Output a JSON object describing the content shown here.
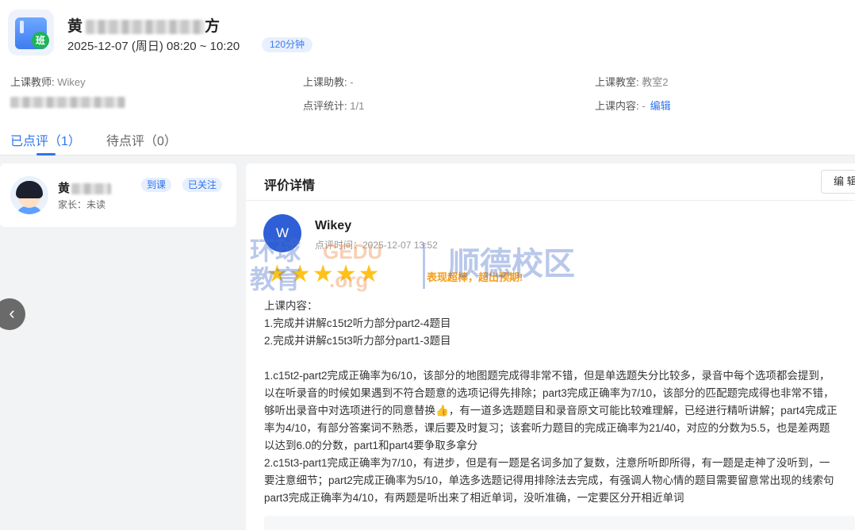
{
  "header": {
    "title_prefix": "黄",
    "title_suffix": "方",
    "time": "2025-12-07 (周日) 08:20 ~ 10:20",
    "duration": "120分钟",
    "icon_badge": "班"
  },
  "info": {
    "teacher_label": "上课教师:",
    "teacher_value": "Wikey",
    "assistant_label": "上课助教:",
    "assistant_value": "-",
    "room_label": "上课教室:",
    "room_value": "教室2",
    "stats_label": "点评统计:",
    "stats_value": "1/1",
    "content_label": "上课内容:",
    "content_value": "-",
    "content_edit": "编辑"
  },
  "tabs": [
    {
      "label": "已点评（1）",
      "active": true
    },
    {
      "label": "待点评（0）",
      "active": false
    }
  ],
  "student": {
    "name_prefix": "黄",
    "parent": "家长：未读",
    "tag_attend": "到课",
    "tag_follow": "已关注"
  },
  "detail": {
    "title": "评价详情",
    "edit_label": "编 辑",
    "reviewer_initial": "W",
    "reviewer_name": "Wikey",
    "review_time": "点评时间：2025-12-07 13:52",
    "stars": "★★★★★",
    "rating_text": "表现超棒，超出预期!",
    "body_lines": [
      "上课内容：",
      "1.完成并讲解c15t2听力部分part2-4题目",
      "2.完成并讲解c15t3听力部分part1-3题目",
      "",
      "1.c15t2-part2完成正确率为6/10，该部分的地图题完成得非常不错，但是单选题失分比较多，录音中每个选项都会提到，",
      "以在听录音的时候如果遇到不符合题意的选项记得先排除；part3完成正确率为7/10，该部分的匹配题完成得也非常不错，",
      "够听出录音中对选项进行的同意替换👍，有一道多选题题目和录音原文可能比较难理解，已经进行精听讲解；part4完成正",
      "率为4/10，有部分答案词不熟悉，课后要及时复习；该套听力题目的完成正确率为21/40，对应的分数为5.5，也是差两题",
      "以达到6.0的分数，part1和part4要争取多拿分",
      "2.c15t3-part1完成正确率为7/10，有进步，但是有一题是名词多加了复数，注意所听即所得，有一题是走神了没听到，一",
      "要注意细节；part2完成正确率为5/10，单选多选题记得用排除法去完成，有强调人物心情的题目需要留意常出现的线索句",
      "part3完成正确率为4/10，有两题是听出来了相近单词，没听准确，一定要区分开相近单词"
    ]
  },
  "watermark": {
    "cn1": "环球",
    "cn2": "教育",
    "en1": "GEDU",
    "en2": ".org",
    "school": "顺德校区"
  },
  "colors": {
    "accent": "#2f74ee",
    "star": "#ffc21a",
    "rating": "#f59d1c",
    "page_bg": "#f2f3f5"
  }
}
